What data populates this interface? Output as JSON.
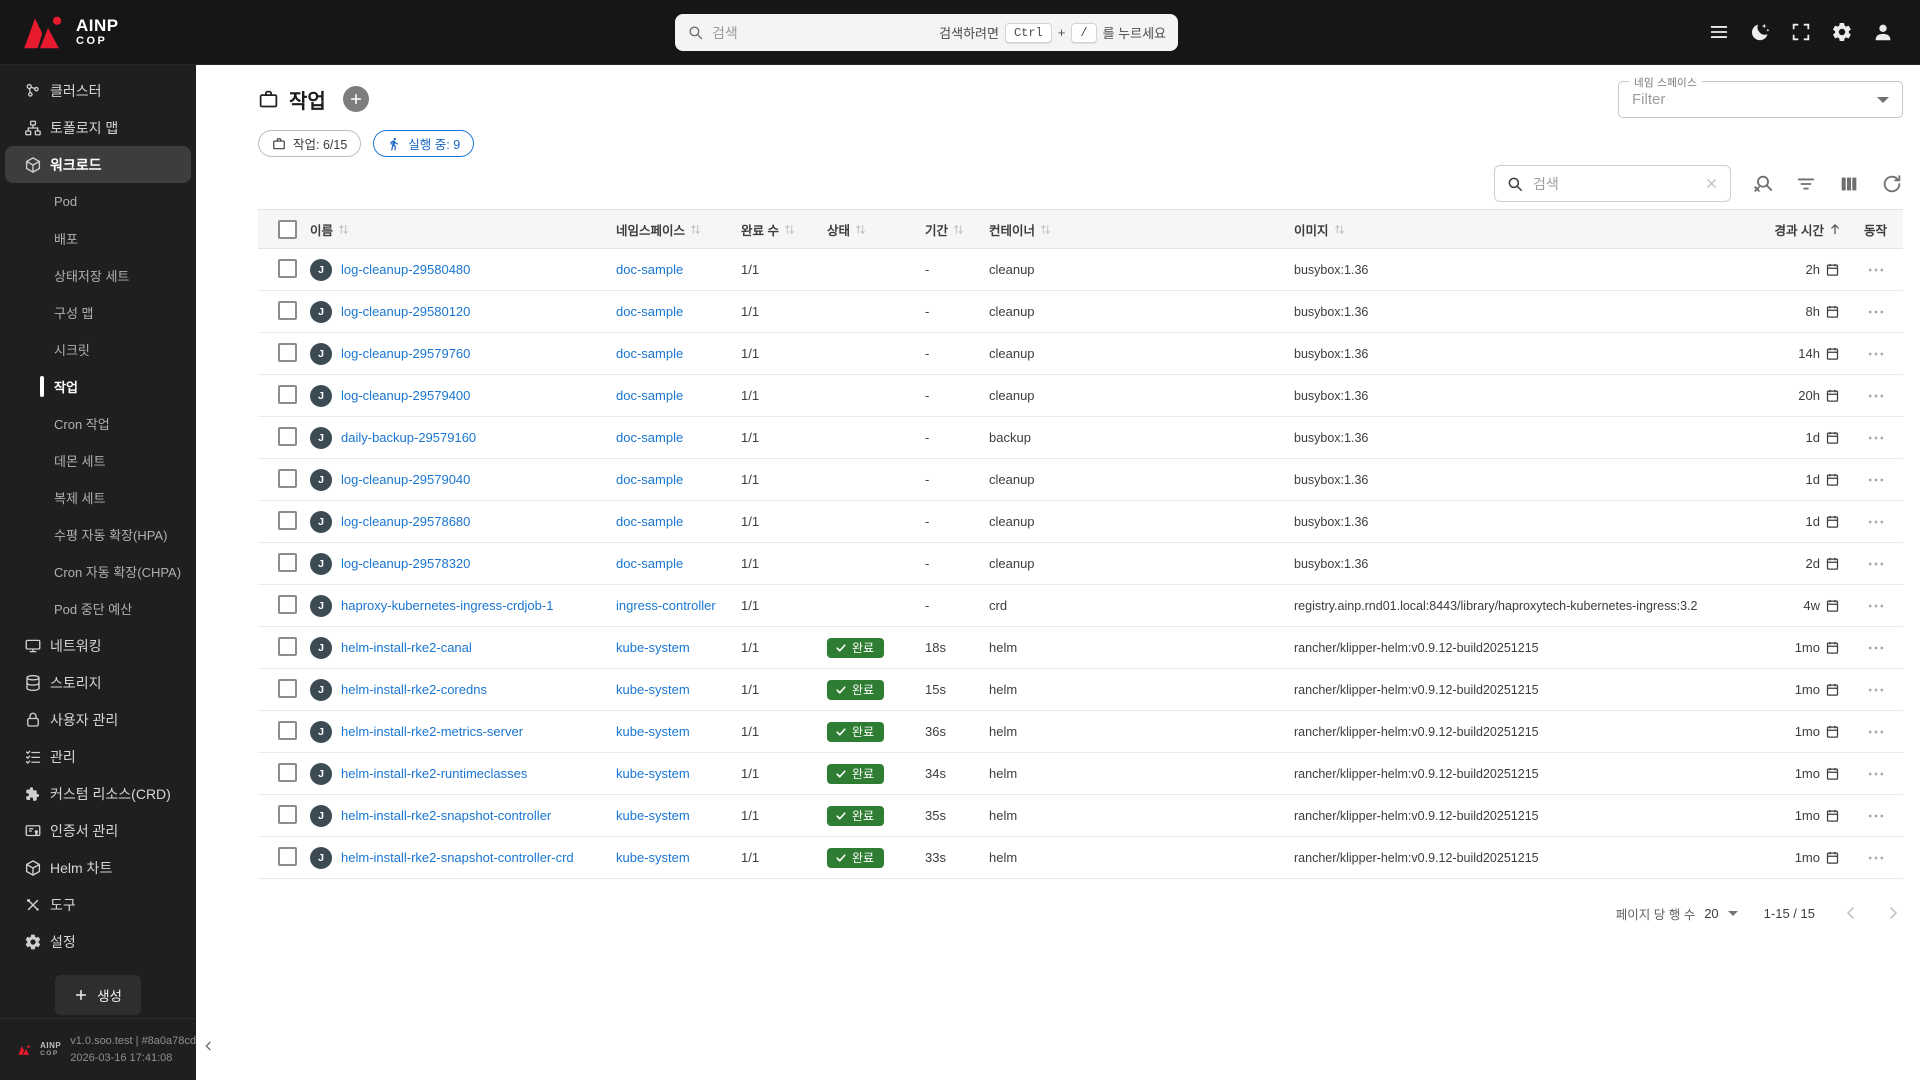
{
  "colors": {
    "accent": "#1976d2",
    "success": "#2e7d32",
    "logo_red": "#e81b2e",
    "topbar_bg": "#161616",
    "sidebar_bg": "#1f1f1f"
  },
  "topbar": {
    "logo_line1": "AINP",
    "logo_line2": "COP",
    "search": {
      "placeholder": "검색",
      "hint_prefix": "검색하려면",
      "key_ctrl": "Ctrl",
      "plus": "+",
      "key_slash": "/",
      "hint_suffix": "를 누르세요"
    }
  },
  "sidebar": {
    "items": [
      {
        "id": "cluster",
        "label": "클러스터",
        "icon": "cluster",
        "level": 0
      },
      {
        "id": "topology-map",
        "label": "토폴로지 맵",
        "icon": "topology",
        "level": 0
      },
      {
        "id": "workloads",
        "label": "워크로드",
        "icon": "cube",
        "level": 0,
        "selected": true
      },
      {
        "id": "pods",
        "label": "Pod",
        "level": 1
      },
      {
        "id": "deployments",
        "label": "배포",
        "level": 1
      },
      {
        "id": "statefulsets",
        "label": "상태저장 세트",
        "level": 1
      },
      {
        "id": "configmaps",
        "label": "구성 맵",
        "level": 1
      },
      {
        "id": "secrets",
        "label": "시크릿",
        "level": 1
      },
      {
        "id": "jobs",
        "label": "작업",
        "level": 1,
        "active": true
      },
      {
        "id": "cronjobs",
        "label": "Cron 작업",
        "level": 1
      },
      {
        "id": "daemonsets",
        "label": "데몬 세트",
        "level": 1
      },
      {
        "id": "replicasets",
        "label": "복제 세트",
        "level": 1
      },
      {
        "id": "hpa",
        "label": "수평 자동 확장(HPA)",
        "level": 1
      },
      {
        "id": "chpa",
        "label": "Cron 자동 확장(CHPA)",
        "level": 1
      },
      {
        "id": "pdb",
        "label": "Pod 중단 예산",
        "level": 1
      },
      {
        "id": "networking",
        "label": "네트워킹",
        "icon": "networking",
        "level": 0
      },
      {
        "id": "storage",
        "label": "스토리지",
        "icon": "storage",
        "level": 0
      },
      {
        "id": "user-management",
        "label": "사용자 관리",
        "icon": "lock",
        "level": 0
      },
      {
        "id": "management",
        "label": "관리",
        "icon": "checklist",
        "level": 0
      },
      {
        "id": "custom-resources",
        "label": "커스텀 리소스(CRD)",
        "icon": "puzzle",
        "level": 0
      },
      {
        "id": "certificates",
        "label": "인증서 관리",
        "icon": "certificate",
        "level": 0
      },
      {
        "id": "helm-charts",
        "label": "Helm 차트",
        "icon": "cube",
        "level": 0
      },
      {
        "id": "tools",
        "label": "도구",
        "icon": "tools",
        "level": 0
      },
      {
        "id": "settings",
        "label": "설정",
        "icon": "gear",
        "level": 0
      }
    ],
    "create_label": "생성",
    "footer": {
      "version": "v1.0.soo.test | #8a0a78cd",
      "datetime": "2026-03-16 17:41:08"
    }
  },
  "page": {
    "title": "작업",
    "namespace_filter": {
      "label": "네임 스페이스",
      "placeholder": "Filter"
    },
    "badges": {
      "jobs_label": "작업: 6/15",
      "running_label": "실행 중: 9"
    },
    "toolbar": {
      "search_placeholder": "검색"
    },
    "table": {
      "avatar_letter": "J",
      "columns": [
        "이름",
        "네임스페이스",
        "완료 수",
        "상태",
        "기간",
        "컨테이너",
        "이미지",
        "경과 시간",
        "동작"
      ],
      "status_done_label": "완료",
      "rows": [
        {
          "name": "log-cleanup-29580480",
          "namespace": "doc-sample",
          "completions": "1/1",
          "status": "",
          "duration": "-",
          "container": "cleanup",
          "image": "busybox:1.36",
          "age": "2h"
        },
        {
          "name": "log-cleanup-29580120",
          "namespace": "doc-sample",
          "completions": "1/1",
          "status": "",
          "duration": "-",
          "container": "cleanup",
          "image": "busybox:1.36",
          "age": "8h"
        },
        {
          "name": "log-cleanup-29579760",
          "namespace": "doc-sample",
          "completions": "1/1",
          "status": "",
          "duration": "-",
          "container": "cleanup",
          "image": "busybox:1.36",
          "age": "14h"
        },
        {
          "name": "log-cleanup-29579400",
          "namespace": "doc-sample",
          "completions": "1/1",
          "status": "",
          "duration": "-",
          "container": "cleanup",
          "image": "busybox:1.36",
          "age": "20h"
        },
        {
          "name": "daily-backup-29579160",
          "namespace": "doc-sample",
          "completions": "1/1",
          "status": "",
          "duration": "-",
          "container": "backup",
          "image": "busybox:1.36",
          "age": "1d"
        },
        {
          "name": "log-cleanup-29579040",
          "namespace": "doc-sample",
          "completions": "1/1",
          "status": "",
          "duration": "-",
          "container": "cleanup",
          "image": "busybox:1.36",
          "age": "1d"
        },
        {
          "name": "log-cleanup-29578680",
          "namespace": "doc-sample",
          "completions": "1/1",
          "status": "",
          "duration": "-",
          "container": "cleanup",
          "image": "busybox:1.36",
          "age": "1d"
        },
        {
          "name": "log-cleanup-29578320",
          "namespace": "doc-sample",
          "completions": "1/1",
          "status": "",
          "duration": "-",
          "container": "cleanup",
          "image": "busybox:1.36",
          "age": "2d"
        },
        {
          "name": "haproxy-kubernetes-ingress-crdjob-1",
          "namespace": "ingress-controller",
          "completions": "1/1",
          "status": "",
          "duration": "-",
          "container": "crd",
          "image": "registry.ainp.rnd01.local:8443/library/haproxytech-kubernetes-ingress:3.2",
          "age": "4w"
        },
        {
          "name": "helm-install-rke2-canal",
          "namespace": "kube-system",
          "completions": "1/1",
          "status": "완료",
          "duration": "18s",
          "container": "helm",
          "image": "rancher/klipper-helm:v0.9.12-build20251215",
          "age": "1mo"
        },
        {
          "name": "helm-install-rke2-coredns",
          "namespace": "kube-system",
          "completions": "1/1",
          "status": "완료",
          "duration": "15s",
          "container": "helm",
          "image": "rancher/klipper-helm:v0.9.12-build20251215",
          "age": "1mo"
        },
        {
          "name": "helm-install-rke2-metrics-server",
          "namespace": "kube-system",
          "completions": "1/1",
          "status": "완료",
          "duration": "36s",
          "container": "helm",
          "image": "rancher/klipper-helm:v0.9.12-build20251215",
          "age": "1mo"
        },
        {
          "name": "helm-install-rke2-runtimeclasses",
          "namespace": "kube-system",
          "completions": "1/1",
          "status": "완료",
          "duration": "34s",
          "container": "helm",
          "image": "rancher/klipper-helm:v0.9.12-build20251215",
          "age": "1mo"
        },
        {
          "name": "helm-install-rke2-snapshot-controller",
          "namespace": "kube-system",
          "completions": "1/1",
          "status": "완료",
          "duration": "35s",
          "container": "helm",
          "image": "rancher/klipper-helm:v0.9.12-build20251215",
          "age": "1mo"
        },
        {
          "name": "helm-install-rke2-snapshot-controller-crd",
          "namespace": "kube-system",
          "completions": "1/1",
          "status": "완료",
          "duration": "33s",
          "container": "helm",
          "image": "rancher/klipper-helm:v0.9.12-build20251215",
          "age": "1mo"
        }
      ]
    },
    "pagination": {
      "rows_per_page_label": "페이지 당 행 수",
      "rows_per_page": "20",
      "range": "1-15 / 15"
    }
  }
}
